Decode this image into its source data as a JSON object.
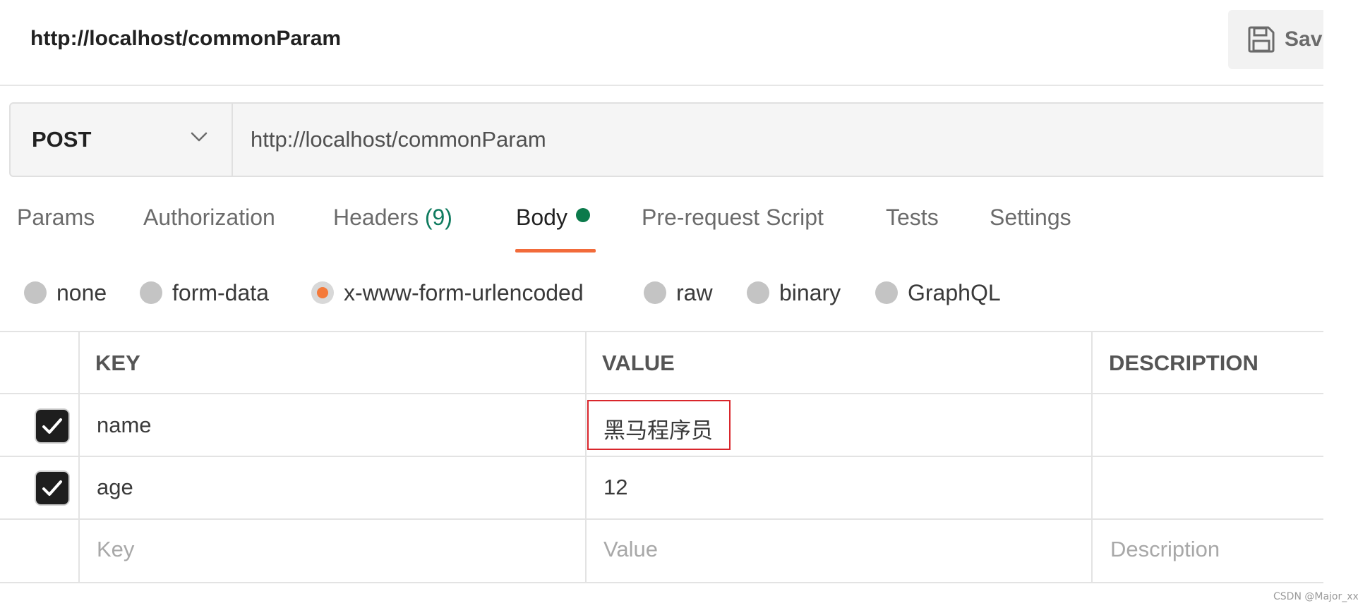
{
  "header": {
    "request_name": "http://localhost/commonParam",
    "save_label": "Sav"
  },
  "request": {
    "method": "POST",
    "url": "http://localhost/commonParam"
  },
  "tabs": {
    "params": "Params",
    "authorization": "Authorization",
    "headers": "Headers",
    "headers_count": "(9)",
    "body": "Body",
    "pre_request_script": "Pre-request Script",
    "tests": "Tests",
    "settings": "Settings",
    "active": "Body"
  },
  "body_types": {
    "none": "none",
    "form_data": "form-data",
    "x_www_form_urlencoded": "x-www-form-urlencoded",
    "raw": "raw",
    "binary": "binary",
    "graphql": "GraphQL",
    "selected": "x-www-form-urlencoded"
  },
  "table": {
    "headers": {
      "key": "KEY",
      "value": "VALUE",
      "description": "DESCRIPTION"
    },
    "rows": [
      {
        "key": "name",
        "value": "黑马程序员",
        "checked": true
      },
      {
        "key": "age",
        "value": "12",
        "checked": true
      }
    ],
    "placeholders": {
      "key": "Key",
      "value": "Value",
      "description": "Description"
    }
  },
  "colors": {
    "accent": "#f26b3a",
    "dot": "#0b7a4b",
    "headers_count": "#0f7b5f",
    "highlight": "#d9262c"
  },
  "watermark": "CSDN @Major_xx"
}
